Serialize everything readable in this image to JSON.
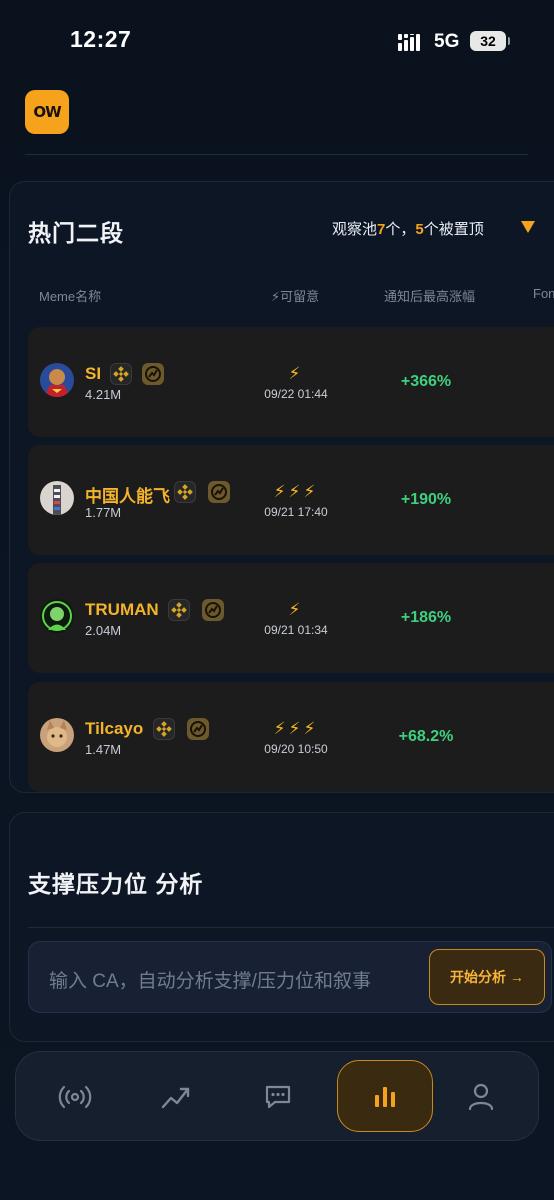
{
  "status_bar": {
    "time": "12:27",
    "network": "5G",
    "battery": "32"
  },
  "logo": {
    "text": "OW"
  },
  "hot": {
    "title": "热门二段",
    "pool": {
      "prefix": "观察池",
      "watch_count": "7",
      "mid": "个，",
      "topped_count": "5",
      "suffix": "个被置顶"
    },
    "columns": [
      "Meme名称",
      "⚡可留意",
      "通知后最高涨幅",
      "Fon"
    ],
    "rows": [
      {
        "name": "SI",
        "mcap": "4.21M",
        "bolts": "⚡",
        "time": "09/22 01:44",
        "gain": "+366%"
      },
      {
        "name": "中国人能飞",
        "mcap": "1.77M",
        "bolts": "⚡⚡⚡",
        "time": "09/21 17:40",
        "gain": "+190%"
      },
      {
        "name": "TRUMAN",
        "mcap": "2.04M",
        "bolts": "⚡",
        "time": "09/21 01:34",
        "gain": "+186%"
      },
      {
        "name": "Tilcayo",
        "mcap": "1.47M",
        "bolts": "⚡⚡⚡",
        "time": "09/20 10:50",
        "gain": "+68.2%"
      }
    ]
  },
  "analysis": {
    "title": "支撑压力位 分析",
    "placeholder": "输入 CA，自动分析支撑/压力位和叙事",
    "button": "开始分析 →"
  },
  "nav": {
    "items": [
      {
        "icon": "broadcast-icon"
      },
      {
        "icon": "trend-icon"
      },
      {
        "icon": "chat-icon"
      },
      {
        "icon": "bar-chart-icon",
        "active": true
      },
      {
        "icon": "user-icon"
      }
    ]
  },
  "colors": {
    "accent": "#f7a21c",
    "gain": "#3ed07e",
    "background": "#0b1320"
  }
}
